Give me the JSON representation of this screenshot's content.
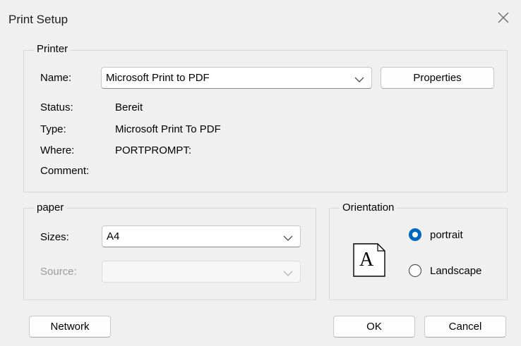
{
  "window": {
    "title": "Print Setup"
  },
  "printer": {
    "group_label": "Printer",
    "name_label": "Name:",
    "name_value": "Microsoft Print to PDF",
    "properties_label": "Properties",
    "status_label": "Status:",
    "status_value": "Bereit",
    "type_label": "Type:",
    "type_value": "Microsoft Print To PDF",
    "where_label": "Where:",
    "where_value": "PORTPROMPT:",
    "comment_label": "Comment:",
    "comment_value": ""
  },
  "paper": {
    "group_label": "paper",
    "sizes_label": "Sizes:",
    "sizes_value": "A4",
    "source_label": "Source:",
    "source_value": ""
  },
  "orientation": {
    "group_label": "Orientation",
    "preview_letter": "A",
    "portrait_label": "portrait",
    "landscape_label": "Landscape",
    "selected": "portrait"
  },
  "footer": {
    "network_label": "Network",
    "ok_label": "OK",
    "cancel_label": "Cancel"
  },
  "colors": {
    "accent": "#0067c0",
    "border": "#d8d8d8",
    "background": "#f0f0f0"
  }
}
